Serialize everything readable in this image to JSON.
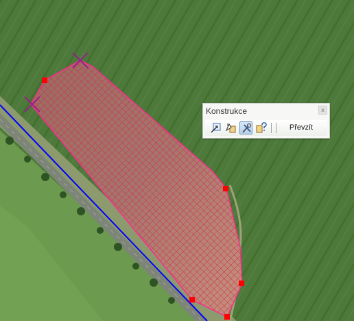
{
  "panel": {
    "title": "Konstrukce",
    "close_glyph": "x",
    "tools": [
      {
        "icon": "draw-polygon-icon"
      },
      {
        "icon": "edit-shape-icon"
      },
      {
        "icon": "construction-tools-icon",
        "active": true
      },
      {
        "icon": "help-icon"
      }
    ],
    "accept_label": "Převzít"
  },
  "map": {
    "layer": "aerial-orthophoto",
    "polygon_fill": "#c8286a",
    "polygon_stroke": "#ff2a8e",
    "vertex_color": "#ff0000",
    "cross_marker_color": "#9a1f8a",
    "line_color": "#0000ff"
  }
}
